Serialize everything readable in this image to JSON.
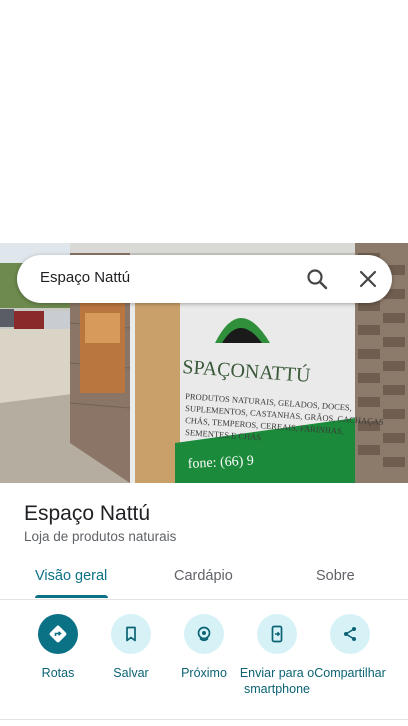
{
  "search": {
    "query": "Espaço Nattú"
  },
  "place": {
    "name": "Espaço Nattú",
    "category": "Loja de produtos naturais"
  },
  "photo": {
    "sign_name": "SPAÇONATTÚ",
    "sign_lines": [
      "PRODUTOS NATURAIS, GELADOS, DOCES,",
      "SUPLEMENTOS, CASTANHAS, GRÃOS, CACHAÇAS",
      "CHÁS, TEMPEROS, CEREAIS, FARINHAS,",
      "SEMENTES E CHÁS"
    ],
    "phone_text": "fone: (66) 9"
  },
  "tabs": [
    {
      "label": "Visão geral"
    },
    {
      "label": "Cardápio"
    },
    {
      "label": "Sobre"
    }
  ],
  "actions": [
    {
      "label": "Rotas",
      "icon": "directions-icon"
    },
    {
      "label": "Salvar",
      "icon": "bookmark-icon"
    },
    {
      "label": "Próximo",
      "icon": "nearby-icon"
    },
    {
      "label": "Enviar para o smartphone",
      "icon": "send-to-phone-icon"
    },
    {
      "label": "Compartilhar",
      "icon": "share-icon"
    }
  ],
  "colors": {
    "accent": "#0b7285",
    "accent_light": "#d6f2f7"
  }
}
